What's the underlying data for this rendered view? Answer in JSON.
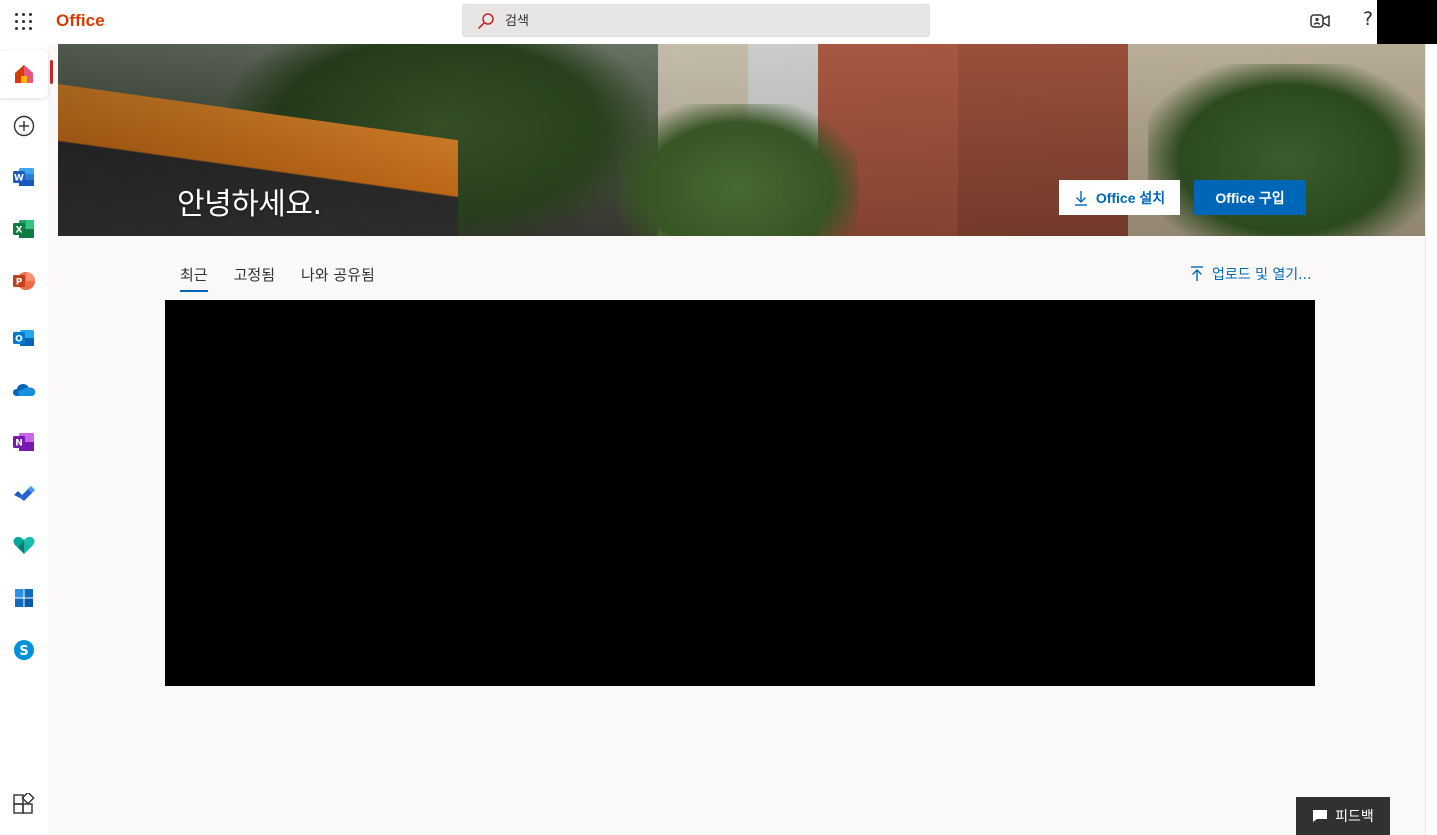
{
  "header": {
    "brand": "Office",
    "search_placeholder": "검색",
    "help_glyph": "?"
  },
  "rail": {
    "items": [
      {
        "name": "home",
        "active": true
      },
      {
        "name": "create"
      },
      {
        "name": "word"
      },
      {
        "name": "excel"
      },
      {
        "name": "powerpoint"
      },
      {
        "name": "outlook"
      },
      {
        "name": "onedrive"
      },
      {
        "name": "onenote"
      },
      {
        "name": "to-do"
      },
      {
        "name": "family-safety"
      },
      {
        "name": "windows"
      },
      {
        "name": "skype"
      }
    ],
    "bottom_item": "all-apps"
  },
  "hero": {
    "greeting": "안녕하세요.",
    "install_label": "Office 설치",
    "buy_label": "Office 구입"
  },
  "tabs": [
    {
      "label": "최근",
      "active": true
    },
    {
      "label": "고정됨"
    },
    {
      "label": "나와 공유됨"
    }
  ],
  "upload_label": "업로드 및 열기...",
  "feedback_label": "피드백",
  "colors": {
    "brand": "#d83b01",
    "accent": "#0067b8",
    "active_indicator": "#c4262e"
  }
}
